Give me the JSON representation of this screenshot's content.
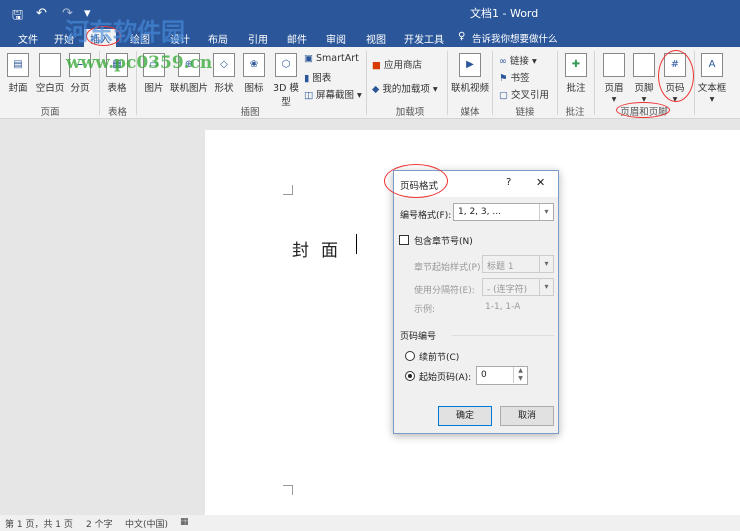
{
  "title": "文档1  -  Word",
  "quick_access": {
    "save": "🖫",
    "undo": "↶",
    "redo": "↷",
    "customize": "▾"
  },
  "tabs": [
    "文件",
    "开始",
    "插入",
    "绘图",
    "设计",
    "布局",
    "引用",
    "邮件",
    "审阅",
    "视图",
    "开发工具"
  ],
  "active_tab": "插入",
  "tell_me": "告诉我你想要做什么",
  "ribbon": {
    "groups": [
      {
        "label": "页面",
        "buttons": [
          "封面",
          "空白页",
          "分页"
        ]
      },
      {
        "label": "表格",
        "buttons": [
          "表格"
        ]
      },
      {
        "label": "插图",
        "buttons": [
          "图片",
          "联机图片",
          "形状",
          "图标",
          "3D 模型"
        ],
        "small": [
          "SmartArt",
          "图表",
          "屏幕截图"
        ]
      },
      {
        "label": "加载项",
        "small": [
          "应用商店",
          "我的加载项"
        ]
      },
      {
        "label": "媒体",
        "buttons": [
          "联机视频"
        ]
      },
      {
        "label": "链接",
        "small": [
          "链接",
          "书签",
          "交叉引用"
        ]
      },
      {
        "label": "批注",
        "buttons": [
          "批注"
        ]
      },
      {
        "label": "页眉和页脚",
        "buttons": [
          "页眉",
          "页脚",
          "页码"
        ]
      },
      {
        "label": "",
        "buttons": [
          "文本框"
        ]
      }
    ]
  },
  "document": {
    "text": "封面"
  },
  "dialog": {
    "title": "页码格式",
    "help": "?",
    "close": "✕",
    "number_format_label": "编号格式(F):",
    "number_format_value": "1, 2, 3, ...",
    "include_chapter_label": "包含章节号(N)",
    "include_chapter_checked": false,
    "chapter_style_label": "章节起始样式(P)",
    "chapter_style_value": "标题 1",
    "separator_label": "使用分隔符(E):",
    "separator_value": "-  (连字符)",
    "example_label": "示例:",
    "example_value": "1-1, 1-A",
    "numbering_section": "页码编号",
    "continue_label": "续前节(C)",
    "start_at_label": "起始页码(A):",
    "start_at_value": "0",
    "start_at_selected": true,
    "ok": "确定",
    "cancel": "取消"
  },
  "status": {
    "page": "第 1 页，共 1 页",
    "words": "2 个字",
    "language": "中文(中国)"
  },
  "watermark": {
    "site": "河东软件园",
    "url": "www.pc0359.cn"
  },
  "colors": {
    "accent": "#2b579a",
    "annotation": "#ee3333"
  }
}
